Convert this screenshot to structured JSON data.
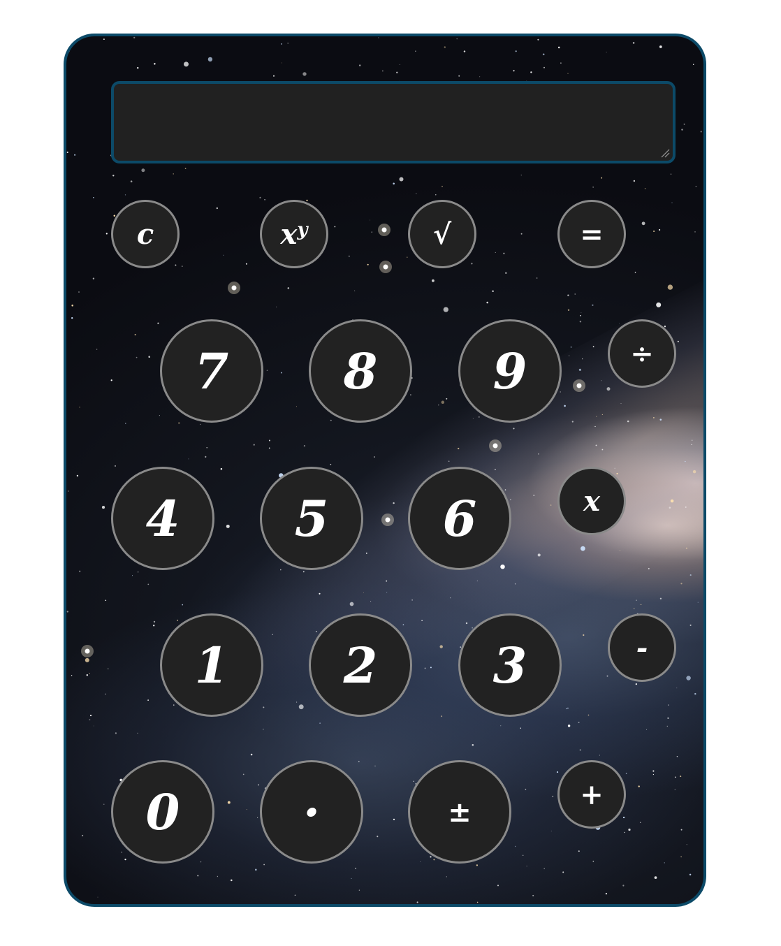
{
  "display": {
    "value": ""
  },
  "buttons": {
    "clear": "c",
    "power_base": "x",
    "power_exp": "y",
    "sqrt": "√",
    "equals": "=",
    "seven": "7",
    "eight": "8",
    "nine": "9",
    "divide": "÷",
    "four": "4",
    "five": "5",
    "six": "6",
    "multiply": "x",
    "one": "1",
    "two": "2",
    "three": "3",
    "subtract": "-",
    "zero": "0",
    "decimal": "·",
    "plus_minus": "±",
    "add": "+"
  },
  "colors": {
    "frame_border": "#0c4a68",
    "button_bg": "#222222",
    "button_border": "#8a8a8a",
    "display_bg": "#212121",
    "text": "#ffffff"
  }
}
